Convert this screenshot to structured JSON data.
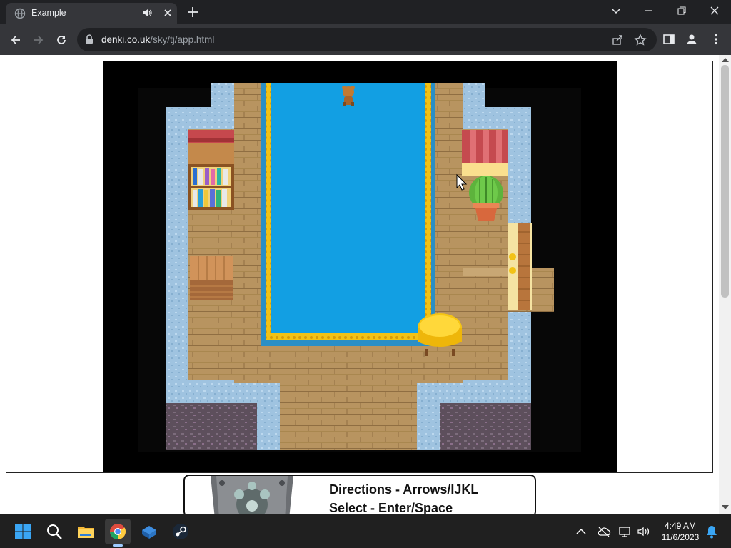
{
  "browser": {
    "tab_title": "Example",
    "url_domain": "denki.co.uk",
    "url_path": "/sky/tj/app.html",
    "icons": [
      "globe-icon",
      "speaker-icon",
      "close-icon",
      "plus-icon",
      "chevron-down-icon",
      "minimize-icon",
      "restore-icon",
      "close-window-icon",
      "back-arrow-icon",
      "forward-arrow-icon",
      "reload-icon",
      "lock-icon",
      "share-icon",
      "star-icon",
      "side-panel-icon",
      "profile-icon",
      "kebab-menu-icon"
    ]
  },
  "controls_panel": {
    "line1": "Directions - Arrows/IJKL",
    "line2": "Select - Enter/Space"
  },
  "taskbar": {
    "apps": [
      "windows-start",
      "search",
      "file-explorer",
      "chrome",
      "virtualbox",
      "steam"
    ],
    "time": "4:49 AM",
    "date": "11/6/2023"
  },
  "colors": {
    "chrome_dark": "#202124",
    "chrome_tab": "#35363a",
    "game_bg": "#000000",
    "pool_blue": "#129fe3",
    "wood_floor": "#b89460",
    "tile_wall": "#9fc3e0",
    "gold_trim": "#f2c215",
    "cactus_green": "#5db33c",
    "taskbar_bg": "#202020"
  }
}
